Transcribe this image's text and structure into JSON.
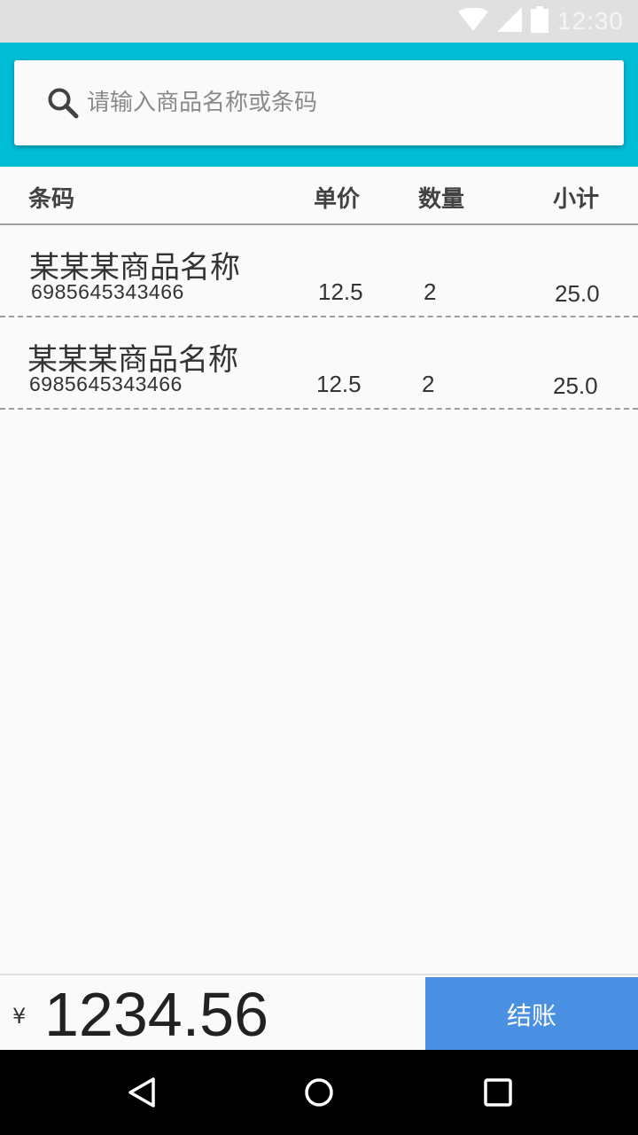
{
  "status_bar": {
    "time": "12:30",
    "icons": [
      "wifi-icon",
      "signal-icon",
      "battery-icon"
    ]
  },
  "search": {
    "placeholder": "请输入商品名称或条码",
    "value": ""
  },
  "table": {
    "headers": {
      "barcode": "条码",
      "price": "单价",
      "quantity": "数量",
      "subtotal": "小计"
    },
    "rows": [
      {
        "name": "某某某商品名称",
        "code": "6985645343466",
        "price": "12.5",
        "quantity": "2",
        "subtotal": "25.0"
      },
      {
        "name": "某某某商品名称",
        "code": "6985645343466",
        "price": "12.5",
        "quantity": "2",
        "subtotal": "25.0"
      }
    ]
  },
  "footer": {
    "currency": "¥",
    "total": "1234.56",
    "checkout_label": "结账"
  },
  "nav": {
    "icons": [
      "back-icon",
      "home-icon",
      "recents-icon"
    ]
  },
  "colors": {
    "accent": "#00bcd4",
    "button": "#4a90e2"
  }
}
